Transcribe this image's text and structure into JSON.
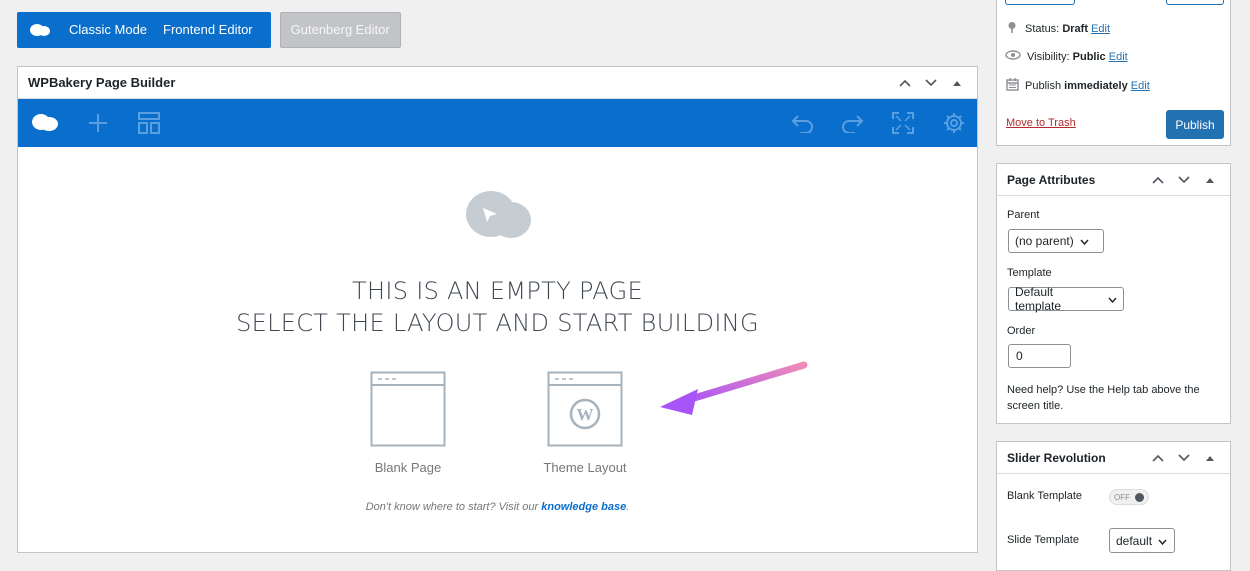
{
  "top_buttons": {
    "classic": "Classic Mode",
    "frontend": "Frontend Editor",
    "gutenberg": "Gutenberg Editor"
  },
  "builder": {
    "title": "WPBakery Page Builder",
    "empty_line1": "THIS IS AN EMPTY PAGE",
    "empty_line2": "SELECT THE LAYOUT AND START BUILDING",
    "layouts": [
      {
        "label": "Blank Page"
      },
      {
        "label": "Theme Layout"
      }
    ],
    "help_prefix": "Don't know where to start? Visit our ",
    "help_link": "knowledge base",
    "help_suffix": ".",
    "toolbar_color": "#0a6ecc"
  },
  "publish": {
    "status_label": "Status:",
    "status_value": "Draft",
    "visibility_label": "Visibility:",
    "visibility_value": "Public",
    "publish_label": "Publish",
    "publish_value": "immediately",
    "edit": "Edit",
    "trash": "Move to Trash",
    "publish_button": "Publish"
  },
  "page_attributes": {
    "title": "Page Attributes",
    "parent_label": "Parent",
    "parent_value": "(no parent)",
    "template_label": "Template",
    "template_value": "Default template",
    "order_label": "Order",
    "order_value": "0",
    "help": "Need help? Use the Help tab above the screen title."
  },
  "slider_revolution": {
    "title": "Slider Revolution",
    "blank_label": "Blank Template",
    "blank_toggle": "OFF",
    "slide_label": "Slide Template",
    "slide_value": "default"
  }
}
